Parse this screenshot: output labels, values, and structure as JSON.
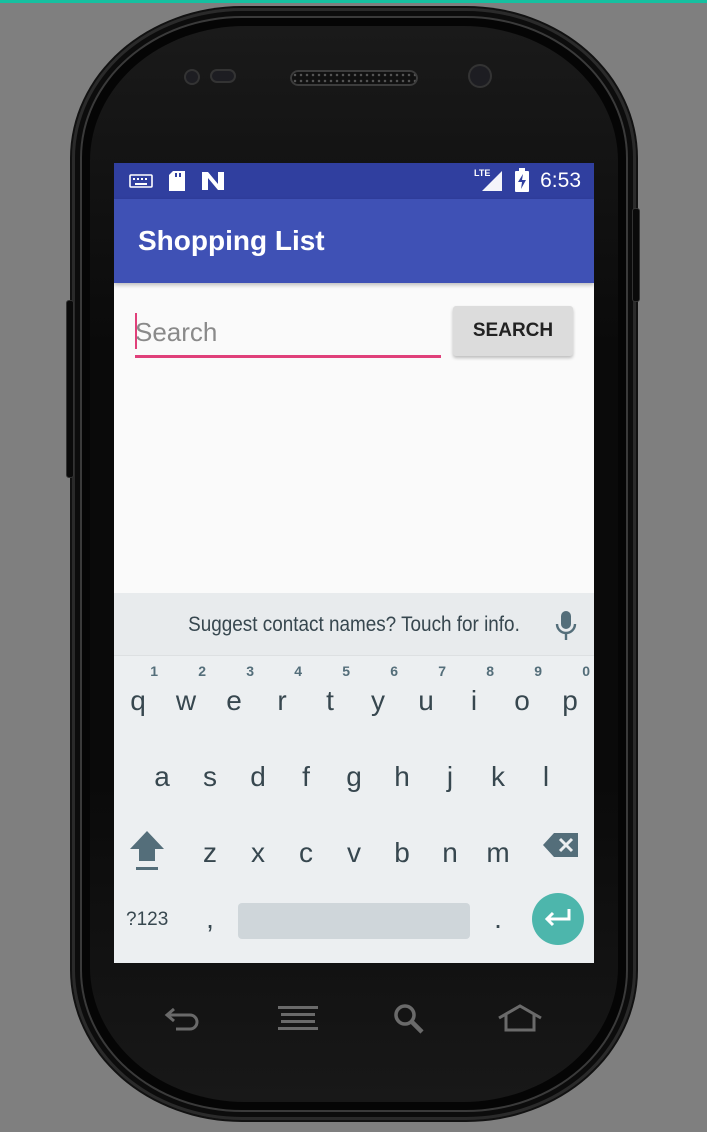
{
  "status_bar": {
    "time": "6:53",
    "network_label": "LTE",
    "icons": [
      "keyboard-icon",
      "sd-card-icon",
      "n-logo-icon",
      "lte-signal-icon",
      "battery-charging-icon"
    ]
  },
  "app_bar": {
    "title": "Shopping List"
  },
  "search": {
    "placeholder": "Search",
    "value": "",
    "button_label": "SEARCH"
  },
  "keyboard": {
    "suggestion": "Suggest contact names? Touch for info.",
    "row1": [
      {
        "key": "q",
        "hint": "1"
      },
      {
        "key": "w",
        "hint": "2"
      },
      {
        "key": "e",
        "hint": "3"
      },
      {
        "key": "r",
        "hint": "4"
      },
      {
        "key": "t",
        "hint": "5"
      },
      {
        "key": "y",
        "hint": "6"
      },
      {
        "key": "u",
        "hint": "7"
      },
      {
        "key": "i",
        "hint": "8"
      },
      {
        "key": "o",
        "hint": "9"
      },
      {
        "key": "p",
        "hint": "0"
      }
    ],
    "row2": [
      "a",
      "s",
      "d",
      "f",
      "g",
      "h",
      "j",
      "k",
      "l"
    ],
    "row3": [
      "z",
      "x",
      "c",
      "v",
      "b",
      "n",
      "m"
    ],
    "symbols_label": "?123",
    "comma_label": ",",
    "period_label": "."
  },
  "nav_bar": {
    "icons": [
      "back-icon",
      "menu-icon",
      "search-icon",
      "home-icon"
    ]
  },
  "colors": {
    "status_bar": "#303f9f",
    "app_bar": "#3f51b5",
    "accent": "#e0407a",
    "enter_key": "#4db6ac",
    "keyboard_bg": "#eceff1"
  }
}
